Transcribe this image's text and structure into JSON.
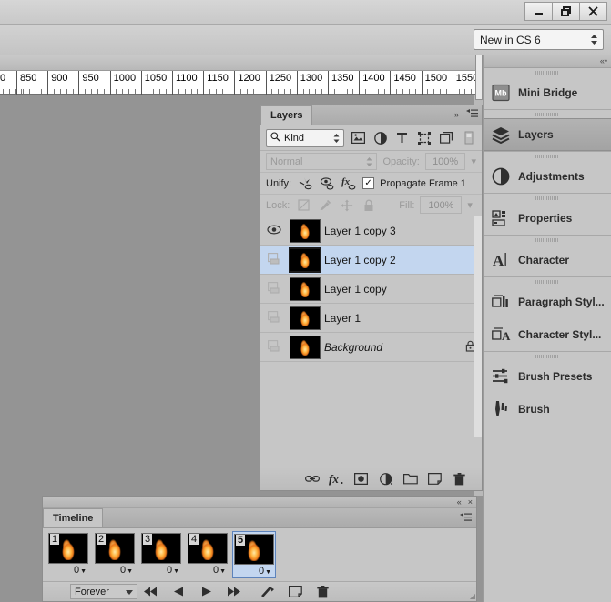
{
  "window": {
    "minimize_label": "–",
    "restore_label": "❐",
    "close_label": "×"
  },
  "options_bar": {
    "workspace_label": "New in CS 6"
  },
  "ruler": {
    "unit_ticks": [
      "0",
      "850",
      "900",
      "950",
      "1000",
      "1050",
      "1100",
      "1150",
      "1200",
      "1250",
      "1300",
      "1350",
      "1400",
      "1450",
      "1500",
      "1550"
    ]
  },
  "dock": {
    "groups": [
      {
        "items": [
          {
            "label": "Mini Bridge",
            "icon": "mini-bridge-icon",
            "active": false
          }
        ]
      },
      {
        "items": [
          {
            "label": "Layers",
            "icon": "layers-icon",
            "active": true
          }
        ]
      },
      {
        "items": [
          {
            "label": "Adjustments",
            "icon": "adjustments-icon",
            "active": false
          }
        ]
      },
      {
        "items": [
          {
            "label": "Properties",
            "icon": "properties-icon",
            "active": false
          }
        ]
      },
      {
        "items": [
          {
            "label": "Character",
            "icon": "character-icon",
            "active": false
          }
        ]
      },
      {
        "items": [
          {
            "label": "Paragraph Styl...",
            "icon": "paragraph-styles-icon",
            "active": false
          },
          {
            "label": "Character Styl...",
            "icon": "character-styles-icon",
            "active": false
          }
        ]
      },
      {
        "items": [
          {
            "label": "Brush Presets",
            "icon": "brush-presets-icon",
            "active": false
          },
          {
            "label": "Brush",
            "icon": "brush-icon",
            "active": false
          }
        ]
      }
    ]
  },
  "layers_panel": {
    "tab_label": "Layers",
    "collapse_icon": "»",
    "menu_icon": "≡",
    "filter": {
      "search_icon": "search-icon",
      "kind_label": "Kind",
      "icons": [
        "pixel-filter-icon",
        "adjustment-filter-icon",
        "type-filter-icon",
        "shape-filter-icon",
        "smart-object-filter-icon"
      ],
      "toggle_icon": "filter-toggle-icon"
    },
    "blend": {
      "mode": "Normal",
      "opacity_label": "Opacity:",
      "opacity_value": "100%"
    },
    "unify": {
      "label": "Unify:",
      "icons": [
        "unify-position-icon",
        "unify-visibility-icon",
        "unify-style-icon"
      ],
      "checkbox_checked": true,
      "checkbox_mark": "✓",
      "propagate_label": "Propagate Frame 1"
    },
    "lock": {
      "label": "Lock:",
      "icons": [
        "lock-transparent-icon",
        "lock-image-icon",
        "lock-position-icon",
        "lock-all-icon"
      ],
      "fill_label": "Fill:",
      "fill_value": "100%"
    },
    "layers": [
      {
        "name": "Layer 1 copy 3",
        "visible": true,
        "selected": false,
        "locked": false,
        "italic": false
      },
      {
        "name": "Layer 1 copy 2",
        "visible": false,
        "selected": true,
        "locked": false,
        "italic": false
      },
      {
        "name": "Layer 1 copy",
        "visible": false,
        "selected": false,
        "locked": false,
        "italic": false
      },
      {
        "name": "Layer 1",
        "visible": false,
        "selected": false,
        "locked": false,
        "italic": false
      },
      {
        "name": "Background",
        "visible": false,
        "selected": false,
        "locked": true,
        "italic": true
      }
    ],
    "footer_icons": [
      "link-layers-icon",
      "layer-style-fx-icon",
      "add-mask-icon",
      "adjustment-layer-icon",
      "new-group-icon",
      "new-layer-icon",
      "delete-layer-icon"
    ]
  },
  "timeline_panel": {
    "tab_label": "Timeline",
    "collapse_icon": "«",
    "close_icon": "×",
    "menu_icon": "≡",
    "frames": [
      {
        "number": "1",
        "delay": "0",
        "selected": false
      },
      {
        "number": "2",
        "delay": "0",
        "selected": false
      },
      {
        "number": "3",
        "delay": "0",
        "selected": false
      },
      {
        "number": "4",
        "delay": "0",
        "selected": false
      },
      {
        "number": "5",
        "delay": "0",
        "selected": true
      }
    ],
    "loop_label": "Forever",
    "controls": [
      "select-first-frame-button",
      "previous-frame-button",
      "play-button",
      "next-frame-button",
      "tween-button",
      "duplicate-frame-button",
      "delete-frame-button"
    ]
  },
  "colors": {
    "panel_bg": "#c6c6c6",
    "canvas_bg": "#949494",
    "selection_blue": "#c3d6ef",
    "selection_border": "#5d83bb"
  }
}
